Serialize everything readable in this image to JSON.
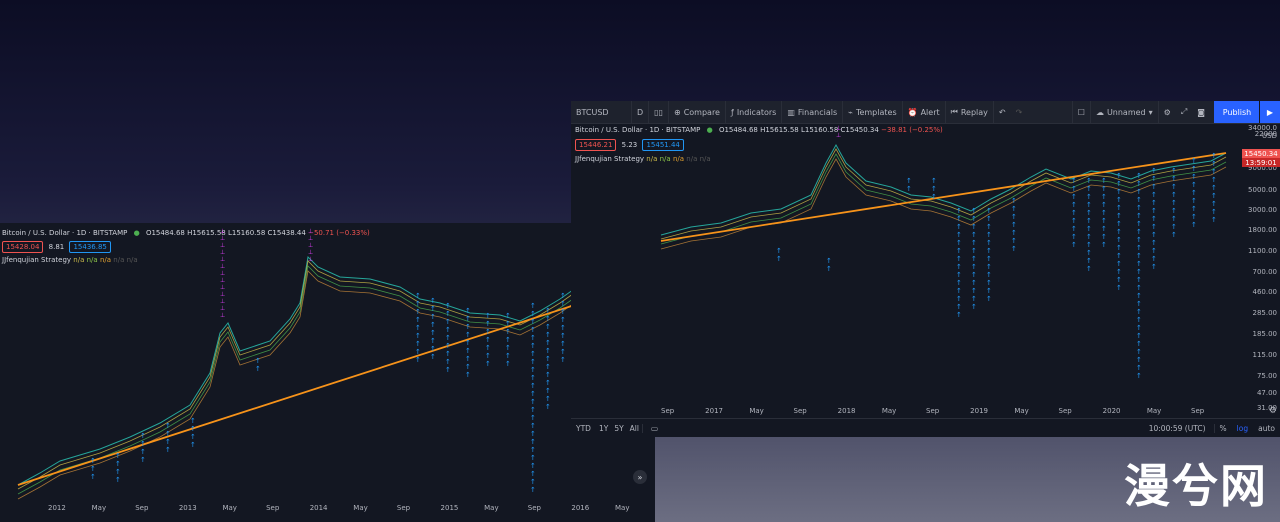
{
  "left_panel": {
    "title": "Bitcoin / U.S. Dollar · 1D · BITSTAMP",
    "ohlc": {
      "o": "O15484.68",
      "h": "H15615.58",
      "l": "L15160.58",
      "c": "C15438.44",
      "chg": "−50.71 (−0.33%)"
    },
    "bid": "15428.04",
    "spread": "8.81",
    "ask": "15436.85",
    "strategy_label": "JJfenqujian Strategy",
    "na_values": [
      "n/a",
      "n/a",
      "n/a",
      "n/a",
      "n/a"
    ],
    "x_ticks": [
      "2012",
      "May",
      "Sep",
      "2013",
      "May",
      "Sep",
      "2014",
      "May",
      "Sep",
      "2015",
      "May",
      "Sep",
      "2016",
      "May"
    ],
    "nav_icon": "double-chevron-right-icon"
  },
  "right_panel": {
    "toolbar": {
      "symbol": "BTCUSD",
      "interval": "D",
      "compare": "Compare",
      "indicators": "Indicators",
      "financials": "Financials",
      "templates": "Templates",
      "alert": "Alert",
      "replay": "Replay",
      "layout_name": "Unnamed",
      "publish": "Publish"
    },
    "title": "Bitcoin / U.S. Dollar · 1D · BITSTAMP",
    "ohlc": {
      "o": "O15484.68",
      "h": "H15615.58",
      "l": "L15160.58",
      "c": "C15450.34",
      "chg": "−38.81 (−0.25%)"
    },
    "bid": "15446.21",
    "spread": "5.23",
    "ask": "15451.44",
    "strategy_label": "JJfenqujian Strategy",
    "na_values": [
      "n/a",
      "n/a",
      "n/a",
      "n/a",
      "n/a"
    ],
    "currency": "USD",
    "y_top": "34000.0",
    "y_ticks": [
      "22000",
      "15450.34",
      "13:59:01",
      "9000.00",
      "5000.00",
      "3000.00",
      "1800.00",
      "1100.00",
      "700.00",
      "460.00",
      "285.00",
      "185.00",
      "115.00",
      "75.00",
      "47.00",
      "31.00"
    ],
    "last_price": "15450.34",
    "countdown": "13:59:01",
    "x_ticks": [
      "Sep",
      "2017",
      "May",
      "Sep",
      "2018",
      "May",
      "Sep",
      "2019",
      "May",
      "Sep",
      "2020",
      "May",
      "Sep"
    ],
    "range_buttons": [
      "YTD",
      "1Y",
      "5Y",
      "All"
    ],
    "clock": "10:00:59 (UTC)",
    "pct": "%",
    "log": "log",
    "auto": "auto"
  },
  "watermark": "漫兮网",
  "colors": {
    "bg": "#131722",
    "orange": "#f7931a",
    "arrow": "#2196f3",
    "magenta": "#e040fb",
    "yellow": "#d4c04a",
    "green": "#4caf50"
  },
  "chart_data": {
    "type": "line",
    "title": "Bitcoin / U.S. Dollar · 1D · BITSTAMP",
    "y_scale": "log",
    "series": [
      {
        "x": [
          "2012",
          "2013",
          "2013-04",
          "2014",
          "2015",
          "2016",
          "2017",
          "2018",
          "2019",
          "2020",
          "2020-11"
        ],
        "values": [
          5,
          13,
          200,
          800,
          300,
          430,
          1000,
          14000,
          3800,
          7200,
          15450
        ]
      }
    ]
  }
}
